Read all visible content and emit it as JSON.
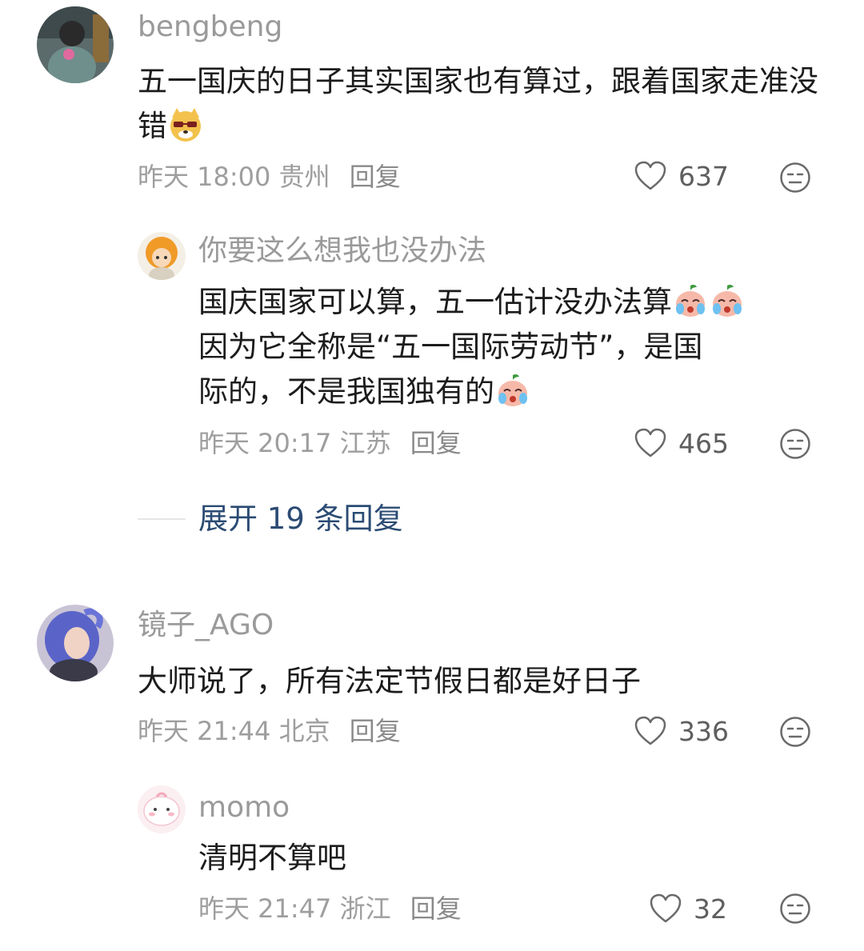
{
  "comments": [
    {
      "username": "bengbeng",
      "text": "五一国庆的日子其实国家也有算过，跟着国家走准没错",
      "time": "昨天 18:00",
      "location": "贵州",
      "reply_label": "回复",
      "likes": "637",
      "reply": {
        "username": "你要这么想我也没办法",
        "text_line1": "国庆国家可以算，五一估计没办法算",
        "text_line2": "因为它全称是“五一国际劳动节”，是国",
        "text_line3": "际的，不是我国独有的",
        "time": "昨天 20:17",
        "location": "江苏",
        "reply_label": "回复",
        "likes": "465"
      },
      "expand_label": "展开 19 条回复"
    },
    {
      "username": "镜子_AGO",
      "text": "大师说了，所有法定节假日都是好日子",
      "time": "昨天 21:44",
      "location": "北京",
      "reply_label": "回复",
      "likes": "336",
      "reply": {
        "username": "momo",
        "text": "清明不算吧",
        "time": "昨天 21:47",
        "location": "浙江",
        "reply_label": "回复",
        "likes": "32"
      }
    }
  ],
  "icons": {
    "like": "heart-outline-icon",
    "emoji": "neutral-face-icon",
    "inline_emoji_1": "dog-sunglasses-emoji",
    "inline_emoji_2": "crying-peach-emoji"
  },
  "colors": {
    "username": "#9a9a9a",
    "text": "#1c1c1c",
    "meta": "#9e9e9e",
    "link": "#2b4b73"
  }
}
